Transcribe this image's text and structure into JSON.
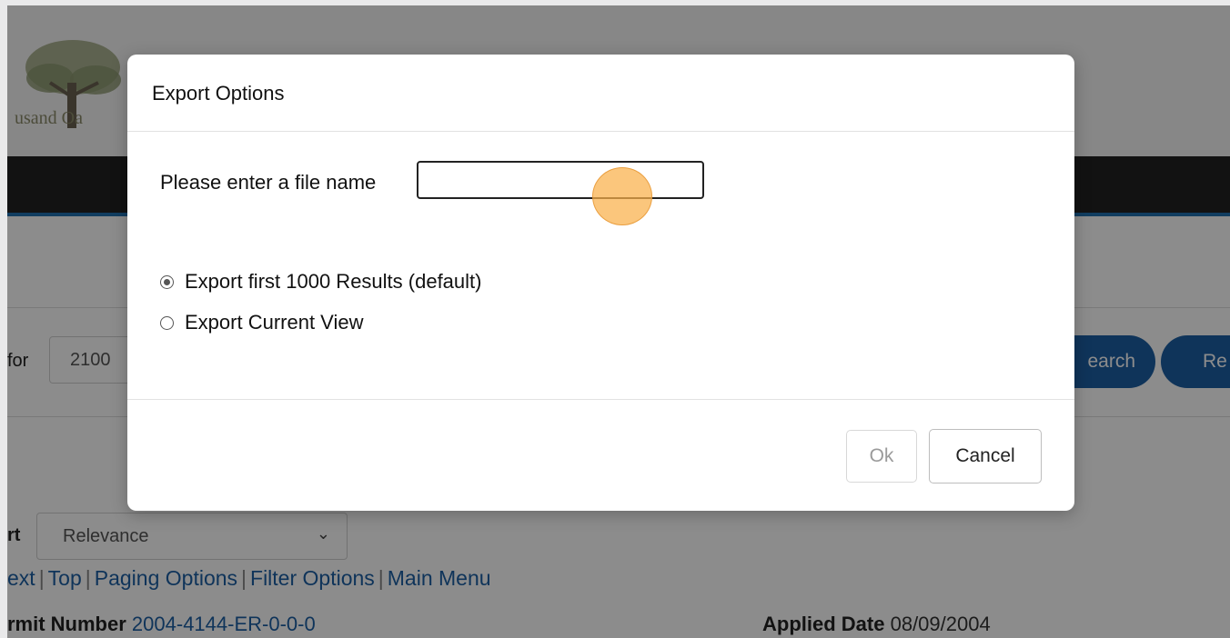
{
  "background": {
    "logo_text": "usand Oa",
    "search_for_label": "for",
    "search_for_value": "2100",
    "search_button_label": "earch",
    "reset_button_label": "Re",
    "sort_label": "rt",
    "sort_value": "Relevance",
    "links": [
      "ext",
      "Top",
      "Paging Options",
      "Filter Options",
      "Main Menu"
    ],
    "permit_label": "rmit Number",
    "permit_value": "2004-4144-ER-0-0-0",
    "applied_label": "Applied Date",
    "applied_value": "08/09/2004"
  },
  "modal": {
    "title": "Export Options",
    "filename_label": "Please enter a file name",
    "filename_value": "",
    "options": [
      {
        "label": "Export first 1000 Results (default)",
        "checked": true
      },
      {
        "label": "Export Current View",
        "checked": false
      }
    ],
    "ok_label": "Ok",
    "cancel_label": "Cancel"
  },
  "colors": {
    "accent": "#1c5fa4",
    "nav": "#222222",
    "cursor_highlight": "#f9b049"
  }
}
